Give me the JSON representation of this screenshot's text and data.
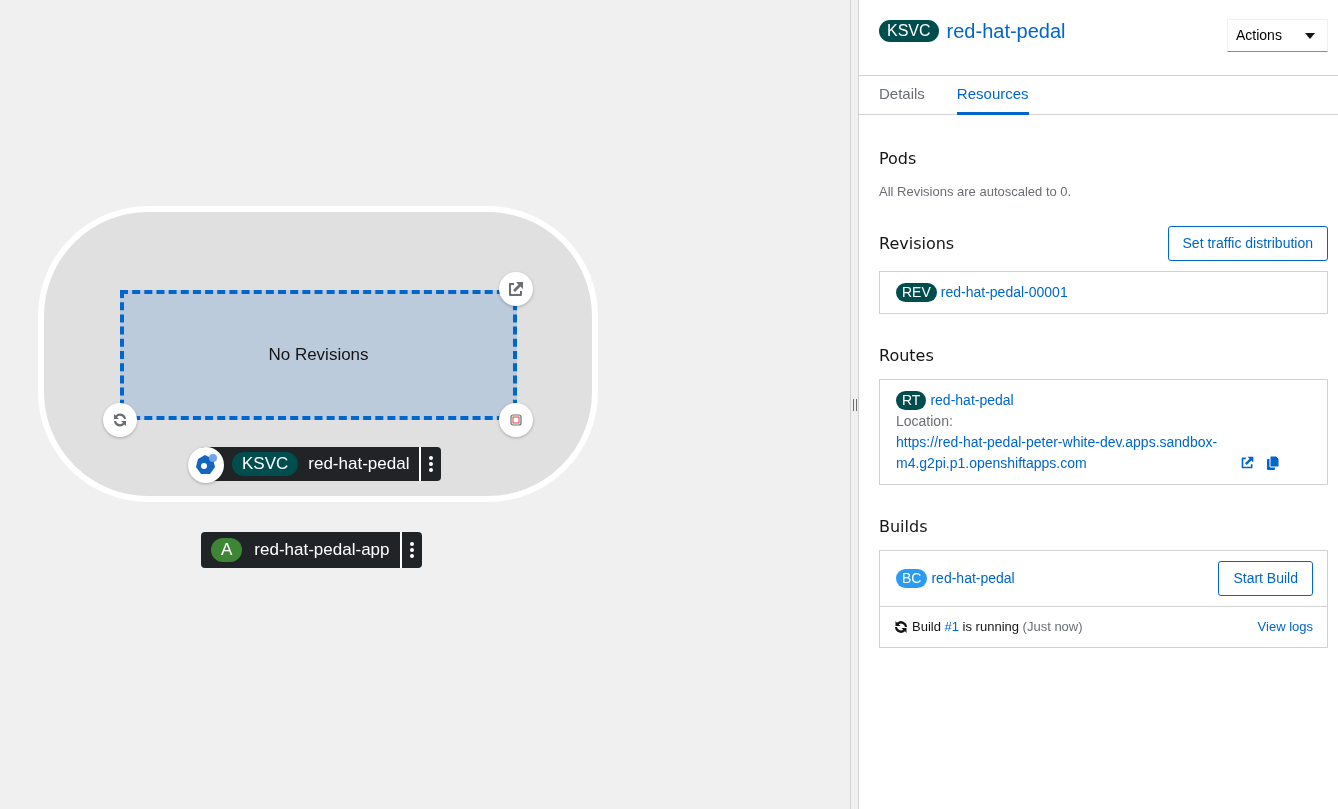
{
  "topology": {
    "service_node": {
      "empty_text": "No Revisions",
      "badge": "KSVC",
      "name": "red-hat-pedal"
    },
    "application": {
      "badge": "A",
      "name": "red-hat-pedal-app"
    }
  },
  "panel": {
    "resource_badge": "KSVC",
    "title": "red-hat-pedal",
    "actions_label": "Actions",
    "tabs": [
      {
        "label": "Details",
        "selected": false
      },
      {
        "label": "Resources",
        "selected": true
      }
    ],
    "pods": {
      "heading": "Pods",
      "message": "All Revisions are autoscaled to 0."
    },
    "revisions": {
      "heading": "Revisions",
      "button": "Set traffic distribution",
      "items": [
        {
          "badge": "REV",
          "name": "red-hat-pedal-00001"
        }
      ]
    },
    "routes": {
      "heading": "Routes",
      "items": [
        {
          "badge": "RT",
          "name": "red-hat-pedal",
          "location_label": "Location:",
          "url": "https://red-hat-pedal-peter-white-dev.apps.sandbox-m4.g2pi.p1.openshiftapps.com"
        }
      ]
    },
    "builds": {
      "heading": "Builds",
      "items": [
        {
          "badge": "BC",
          "name": "red-hat-pedal",
          "button": "Start Build",
          "status": {
            "prefix": "Build",
            "number": "#1",
            "suffix": "is running",
            "time": "(Just now)"
          },
          "logs_link": "View logs"
        }
      ]
    }
  }
}
